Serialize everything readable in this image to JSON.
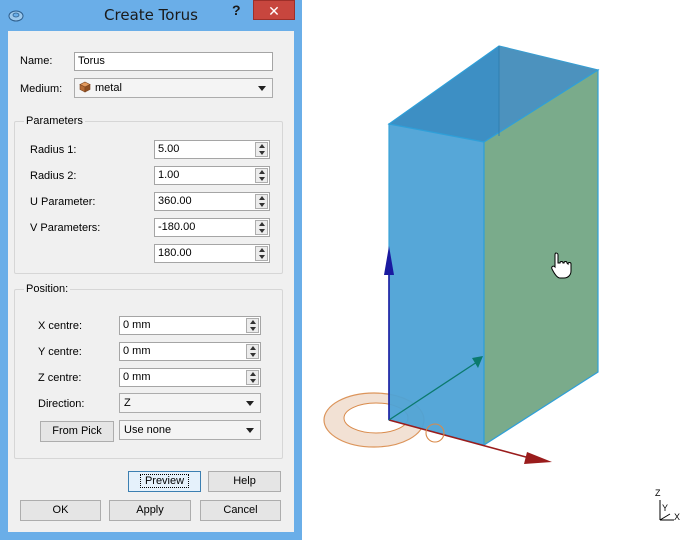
{
  "window": {
    "title": "Create Torus",
    "help": "?",
    "close": "✕"
  },
  "name": {
    "label": "Name:",
    "value": "Torus"
  },
  "medium": {
    "label": "Medium:",
    "value": "metal",
    "icon": "metal-cube-icon"
  },
  "parameters": {
    "title": "Parameters",
    "radius1": {
      "label": "Radius 1:",
      "value": "5.00"
    },
    "radius2": {
      "label": "Radius 2:",
      "value": "1.00"
    },
    "u": {
      "label": "U Parameter:",
      "value": "360.00"
    },
    "v": {
      "label": "V Parameters:",
      "value_min": "-180.00",
      "value_max": "180.00"
    }
  },
  "position": {
    "title": "Position:",
    "x": {
      "label": "X centre:",
      "value": "0 mm"
    },
    "y": {
      "label": "Y centre:",
      "value": "0 mm"
    },
    "z": {
      "label": "Z centre:",
      "value": "0 mm"
    },
    "direction": {
      "label": "Direction:",
      "value": "Z"
    },
    "from_pick": "From Pick",
    "pick_mode": "Use none"
  },
  "buttons": {
    "preview": "Preview",
    "help": "Help",
    "ok": "OK",
    "apply": "Apply",
    "cancel": "Cancel"
  },
  "axis_triad": {
    "z": "Z",
    "y": "Y",
    "x": "X"
  },
  "colors": {
    "titlebar": "#6aaee8",
    "close": "#c7463e",
    "box_front": "#4ea3d6",
    "box_side": "#7aab8b",
    "axis_z": "#1a1aa0",
    "axis_x": "#9a1c1c",
    "axis_y": "#0b7a6e",
    "torus": "#d98a4a"
  }
}
